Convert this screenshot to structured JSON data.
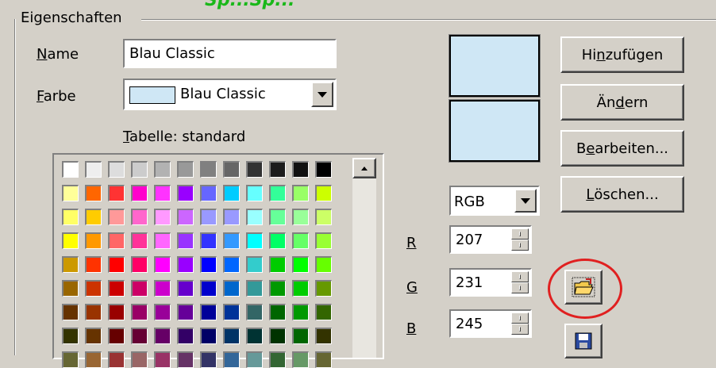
{
  "header_overlay": "Sp...Sp...",
  "group": {
    "title": "Eigenschaften"
  },
  "name_field": {
    "label_prefix": "",
    "label_key": "N",
    "label_rest": "ame",
    "value": "Blau Classic"
  },
  "color_field": {
    "label_key": "F",
    "label_rest": "arbe",
    "value": "Blau Classic",
    "swatch_color": "#cfe7f5"
  },
  "table_label": {
    "key": "T",
    "rest": "abelle: standard"
  },
  "palette_rows": [
    [
      "#ffffff",
      "#eeeeee",
      "#dddddd",
      "#cccccc",
      "#b2b2b2",
      "#999999",
      "#808080",
      "#666666",
      "#333333",
      "#1c1c1c",
      "#111111",
      "#000000"
    ],
    [
      "#ffff99",
      "#ff6600",
      "#ff3333",
      "#ff00cc",
      "#ff33ff",
      "#9900ff",
      "#6666ff",
      "#00ccff",
      "#66ffff",
      "#33ff99",
      "#99ff66",
      "#ccff00"
    ],
    [
      "#ffff66",
      "#ffcc00",
      "#ff9999",
      "#ff66cc",
      "#ff99ff",
      "#cc66ff",
      "#9999ff",
      "#9999ff",
      "#99ffff",
      "#66ff99",
      "#99ff99",
      "#ccff66"
    ],
    [
      "#ffff00",
      "#ff9900",
      "#ff6666",
      "#ff3399",
      "#ff66ff",
      "#9933ff",
      "#3333ff",
      "#3399ff",
      "#00ffff",
      "#00ff66",
      "#66ff66",
      "#99ff33"
    ],
    [
      "#cc9900",
      "#ff3300",
      "#ff0000",
      "#ff0066",
      "#ff00ff",
      "#9900ff",
      "#0000ff",
      "#0066ff",
      "#33cccc",
      "#00cc00",
      "#00ff00",
      "#66ff00"
    ],
    [
      "#996600",
      "#cc3300",
      "#cc0000",
      "#cc0066",
      "#cc00cc",
      "#6600cc",
      "#0000cc",
      "#0066cc",
      "#339999",
      "#009900",
      "#00cc00",
      "#669900"
    ],
    [
      "#663300",
      "#993300",
      "#990000",
      "#990066",
      "#990099",
      "#660099",
      "#000099",
      "#003399",
      "#336666",
      "#006600",
      "#009900",
      "#336600"
    ],
    [
      "#333300",
      "#663300",
      "#660000",
      "#660033",
      "#660066",
      "#330066",
      "#000066",
      "#003366",
      "#003333",
      "#003300",
      "#006600",
      "#333300"
    ],
    [
      "#666633",
      "#996633",
      "#993333",
      "#996666",
      "#993366",
      "#663366",
      "#333366",
      "#336699",
      "#669999",
      "#336633",
      "#669966",
      "#666633"
    ]
  ],
  "buttons": {
    "add": {
      "pre": "Hi",
      "key": "n",
      "post": "zufügen"
    },
    "change": {
      "pre": "Än",
      "key": "d",
      "post": "ern"
    },
    "edit": {
      "pre": "B",
      "key": "e",
      "post": "arbeiten..."
    },
    "delete": {
      "pre": "",
      "key": "L",
      "post": "öschen..."
    }
  },
  "color_mode": {
    "value": "RGB"
  },
  "rgb": {
    "r": {
      "label": "R",
      "value": "207"
    },
    "g": {
      "label": "G",
      "value": "231"
    },
    "b": {
      "label": "B",
      "value": "245"
    }
  },
  "preview_colors": {
    "old": "#cfe7f5",
    "new": "#cfe7f5"
  },
  "highlight_color": "#e02020"
}
